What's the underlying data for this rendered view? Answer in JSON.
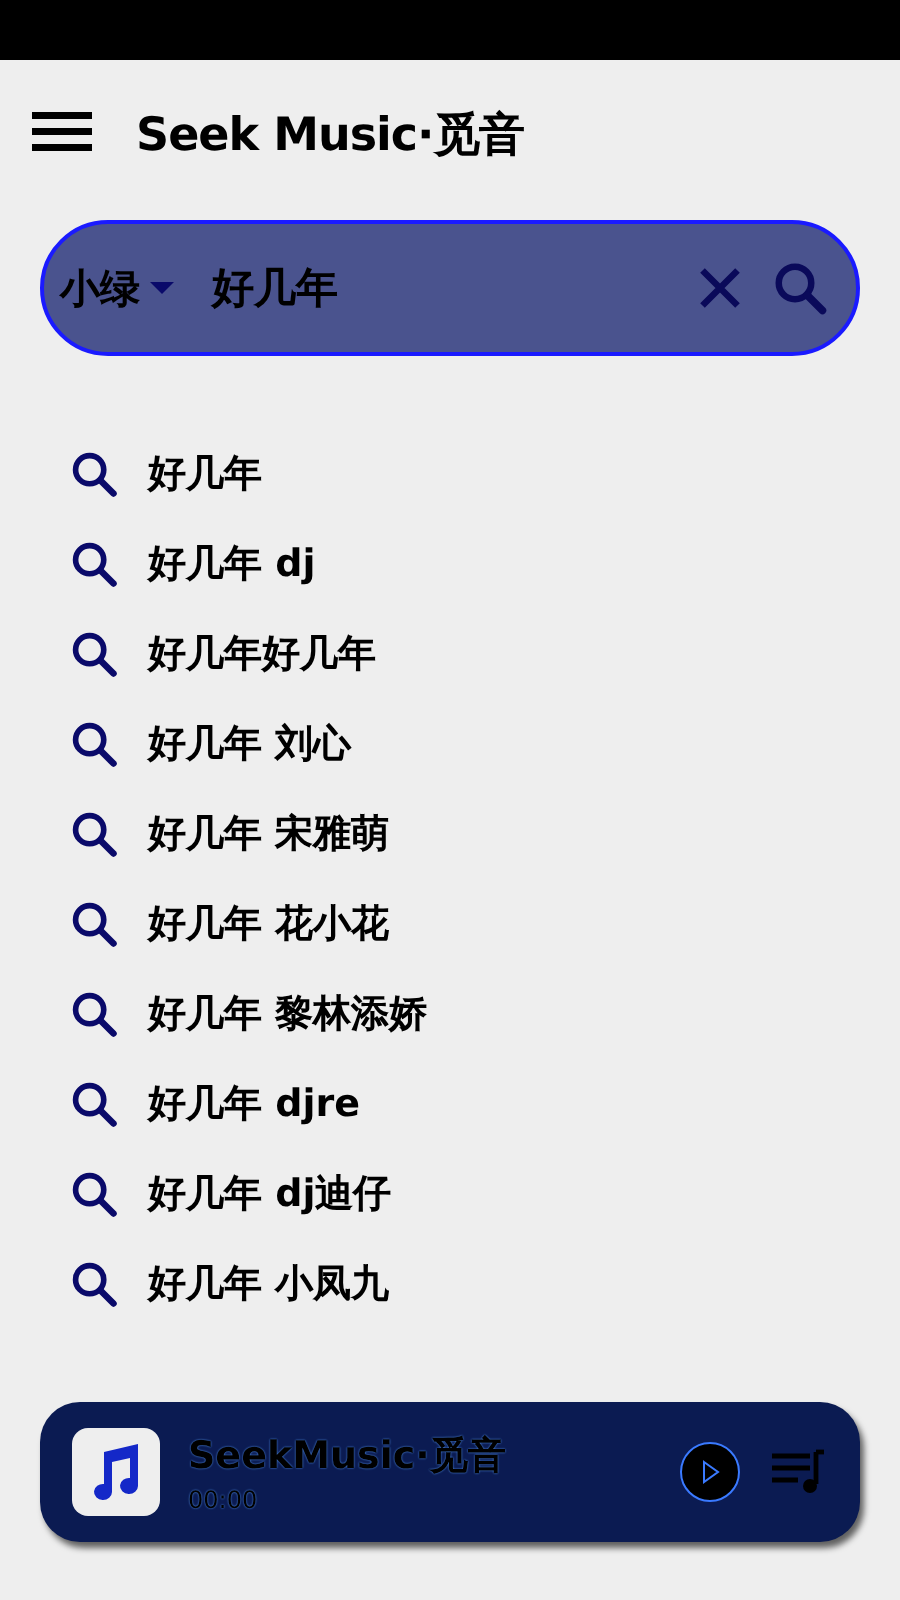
{
  "app_bar": {
    "title": "Seek Music·觅音"
  },
  "search": {
    "source": "小绿",
    "value": "好几年"
  },
  "suggestions": [
    "好几年",
    "好几年 dj",
    "好几年好几年",
    "好几年 刘心",
    "好几年 宋雅萌",
    "好几年 花小花",
    "好几年 黎林添娇",
    "好几年 djre",
    "好几年 dj迪仔",
    "好几年 小凤九"
  ],
  "player": {
    "title": "SeekMusic·觅音",
    "time": "00:00"
  }
}
